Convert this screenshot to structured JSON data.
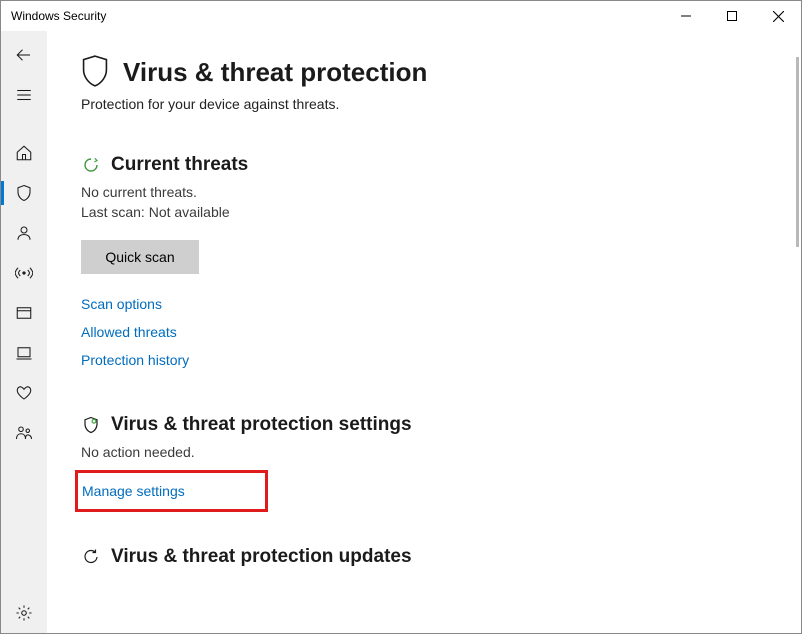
{
  "window": {
    "title": "Windows Security"
  },
  "page": {
    "title": "Virus & threat protection",
    "subtitle": "Protection for your device against threats."
  },
  "sections": {
    "current_threats": {
      "title": "Current threats",
      "line1": "No current threats.",
      "line2": "Last scan: Not available",
      "quick_scan_label": "Quick scan",
      "link_scan_options": "Scan options",
      "link_allowed_threats": "Allowed threats",
      "link_protection_history": "Protection history"
    },
    "settings": {
      "title": "Virus & threat protection settings",
      "status": "No action needed.",
      "link_manage": "Manage settings"
    },
    "updates": {
      "title": "Virus & threat protection updates"
    }
  }
}
